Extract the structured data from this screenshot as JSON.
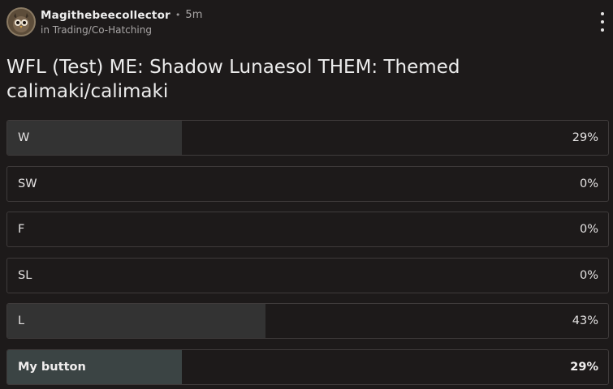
{
  "post": {
    "author": "Magithebeecollector",
    "separator": "•",
    "time": "5m",
    "community": "in Trading/Co-Hatching",
    "menu_icon": "kebab-menu-icon",
    "title": "WFL (Test) ME: Shadow Lunaesol THEM: Themed calimaki/calimaki"
  },
  "poll": {
    "options": [
      {
        "label": "W",
        "percent_label": "29%",
        "percent": 29,
        "selected": false
      },
      {
        "label": "SW",
        "percent_label": "0%",
        "percent": 0,
        "selected": false
      },
      {
        "label": "F",
        "percent_label": "0%",
        "percent": 0,
        "selected": false
      },
      {
        "label": "SL",
        "percent_label": "0%",
        "percent": 0,
        "selected": false
      },
      {
        "label": "L",
        "percent_label": "43%",
        "percent": 43,
        "selected": false
      },
      {
        "label": "My button",
        "percent_label": "29%",
        "percent": 29,
        "selected": true
      }
    ]
  },
  "colors": {
    "background": "#1d1a1a",
    "bar_fill": "#333333",
    "selected_bar_fill": "#3b4444",
    "border": "#3f3b3b"
  }
}
